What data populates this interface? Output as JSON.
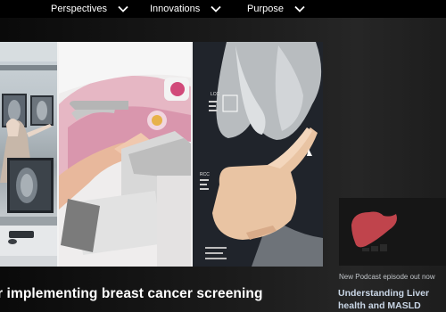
{
  "nav": {
    "items": [
      {
        "label": "Perspectives"
      },
      {
        "label": "Innovations"
      },
      {
        "label": "Purpose"
      }
    ]
  },
  "hero": {
    "headline": "r implementing breast cancer screening",
    "mammogram_labels": {
      "top": "LCC",
      "bottom": "RCC"
    }
  },
  "side_card": {
    "kicker": "New Podcast episode out now",
    "title": "Understanding Liver health and MASLD",
    "icon": "liver-icon",
    "icon_color": "#c0444c"
  },
  "colors": {
    "background": "#000000",
    "link_title": "#c9d6e6"
  }
}
